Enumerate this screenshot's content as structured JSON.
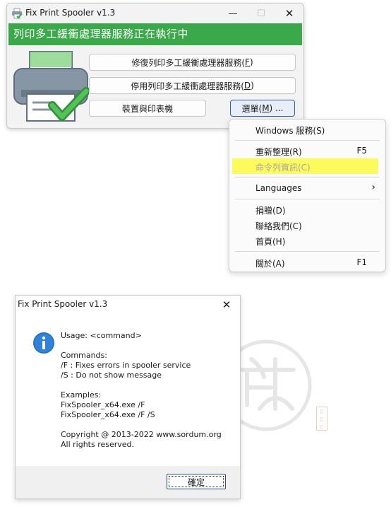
{
  "window": {
    "title": "Fix Print Spooler v1.3",
    "minimize_glyph": "—",
    "maximize_glyph": "☐",
    "close_glyph": "✕",
    "status_text": "列印多工緩衝處理器服務正在執行中",
    "status_color": "#3aa94a",
    "icon": "printer-check-icon"
  },
  "buttons": {
    "repair": {
      "text": "修復列印多工緩衝處理器服務(",
      "key": "F",
      "end": ")"
    },
    "stop": {
      "text": "停用列印多工緩衝處理器服務(",
      "key": "D",
      "end": ")"
    },
    "devices": {
      "label": "裝置與印表機"
    },
    "menu": {
      "text": "選單(",
      "key": "M",
      "end": ") ..."
    }
  },
  "menu": {
    "items": [
      {
        "label": "Windows 服務(S)",
        "shortcut": ""
      },
      {
        "label": "重新整理(R)",
        "shortcut": "F5"
      },
      {
        "label": "命令列資訊(C)",
        "shortcut": ""
      },
      {
        "label": "Languages",
        "shortcut": ""
      },
      {
        "label": "捐贈(D)",
        "shortcut": ""
      },
      {
        "label": "聯絡我們(C)",
        "shortcut": ""
      },
      {
        "label": "首頁(H)",
        "shortcut": ""
      },
      {
        "label": "關於(A)",
        "shortcut": "F1"
      }
    ],
    "submenu_arrow": "›",
    "highlight_color": "#fdfb5c"
  },
  "dialog": {
    "title": "Fix Print Spooler v1.3",
    "close_glyph": "✕",
    "icon": "info-icon",
    "message": "Usage: <command>\n\nCommands:\n/F : Fixes errors in spooler service\n/S : Do not show message\n\nExamples:\nFixSpooler_x64.exe /F\nFixSpooler_x64.exe /F /S\n\nCopyright @ 2013-2022 www.sordum.org\nAll rights reserved.",
    "ok_label": "確定"
  },
  "watermark": {
    "icon": "seal-watermark-icon",
    "stamp_icon": "red-stamp-icon"
  }
}
